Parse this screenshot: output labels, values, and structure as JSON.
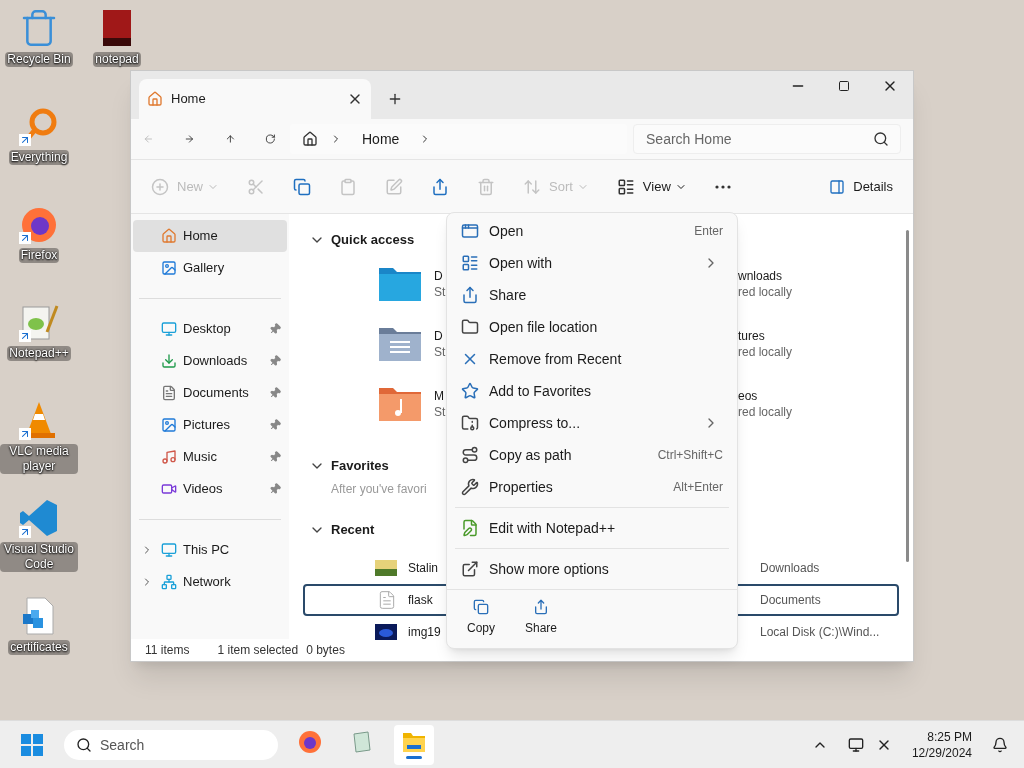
{
  "desktop_icons": [
    {
      "label": "Recycle Bin",
      "kind": "recycle",
      "shortcut": false
    },
    {
      "label": "Everything",
      "kind": "everything",
      "shortcut": true
    },
    {
      "label": "Firefox",
      "kind": "firefox",
      "shortcut": true
    },
    {
      "label": "Notepad++",
      "kind": "notepadpp",
      "shortcut": true
    },
    {
      "label": "VLC media player",
      "kind": "vlc",
      "shortcut": true
    },
    {
      "label": "Visual Studio Code",
      "kind": "vscode",
      "shortcut": true
    },
    {
      "label": "certificates",
      "kind": "certs",
      "shortcut": false
    }
  ],
  "desktop_icons_column_2": [
    {
      "label": "notepad",
      "kind": "book",
      "shortcut": false
    }
  ],
  "window": {
    "tabs": [
      {
        "label": "Home",
        "selected": true
      }
    ],
    "address": {
      "breadcrumb": [
        "Home"
      ],
      "search_placeholder": "Search Home"
    },
    "commands": [
      {
        "kind": "new",
        "label": "New",
        "disabled": true
      },
      {
        "kind": "cut",
        "disabled": true
      },
      {
        "kind": "copy",
        "disabled": false
      },
      {
        "kind": "paste",
        "disabled": true
      },
      {
        "kind": "rename",
        "disabled": true
      },
      {
        "kind": "share",
        "disabled": false
      },
      {
        "kind": "delete",
        "disabled": true
      },
      {
        "kind": "sort",
        "label": "Sort",
        "disabled": true
      },
      {
        "kind": "view",
        "label": "View",
        "disabled": false
      },
      {
        "kind": "more",
        "disabled": false
      }
    ],
    "details_button": "Details",
    "sidebar": {
      "top": [
        {
          "label": "Home",
          "kind": "home",
          "selected": true
        },
        {
          "label": "Gallery",
          "kind": "gallery",
          "selected": false
        }
      ],
      "pinned": [
        {
          "label": "Desktop",
          "kind": "desktop",
          "selected": false,
          "pinned": true
        },
        {
          "label": "Downloads",
          "kind": "downloads",
          "selected": false,
          "pinned": true
        },
        {
          "label": "Documents",
          "kind": "documents",
          "selected": false,
          "pinned": true
        },
        {
          "label": "Pictures",
          "kind": "pictures",
          "selected": false,
          "pinned": true
        },
        {
          "label": "Music",
          "kind": "music",
          "selected": false,
          "pinned": true
        },
        {
          "label": "Videos",
          "kind": "videos",
          "selected": false,
          "pinned": true
        }
      ],
      "locations": [
        {
          "label": "This PC",
          "kind": "pc",
          "selected": false,
          "expanded": false
        },
        {
          "label": "Network",
          "kind": "network",
          "selected": false,
          "expanded": false
        }
      ]
    },
    "quick_access": {
      "title": "Quick access",
      "expanded": true,
      "items": [
        {
          "kind": "desktop",
          "name": "D",
          "status": "St"
        },
        {
          "kind": "documents",
          "name": "D",
          "status": "St"
        },
        {
          "kind": "music",
          "name": "M",
          "status": "St"
        }
      ],
      "items_right": [
        {
          "name": "wnloads",
          "status": "red locally"
        },
        {
          "name": "tures",
          "status": "red locally"
        },
        {
          "name": "eos",
          "status": "red locally"
        }
      ]
    },
    "favorites": {
      "title": "Favorites",
      "expanded": true,
      "hint": "After you've favori"
    },
    "recent": {
      "title": "Recent",
      "expanded": true,
      "rows": [
        {
          "kind": "image",
          "name": "Stalin",
          "location": "Downloads",
          "selected": false
        },
        {
          "kind": "text",
          "name": "flask",
          "location": "Documents",
          "selected": true
        },
        {
          "kind": "dark",
          "name": "img19",
          "location": "Local Disk (C:)\\Wind...",
          "selected": false
        }
      ]
    },
    "status_bar": {
      "count": "11 items",
      "selection": "1 item selected",
      "size": "0 bytes"
    }
  },
  "context_menu": {
    "items": [
      {
        "kind": "open",
        "label": "Open",
        "shortcut": "Enter",
        "submenu": false,
        "divider_above": false
      },
      {
        "kind": "openwith",
        "label": "Open with",
        "submenu": true,
        "divider_above": false
      },
      {
        "kind": "share",
        "label": "Share",
        "submenu": false,
        "divider_above": false
      },
      {
        "kind": "location",
        "label": "Open file location",
        "submenu": false,
        "divider_above": false
      },
      {
        "kind": "remove",
        "label": "Remove from Recent",
        "submenu": false,
        "divider_above": false
      },
      {
        "kind": "favorite",
        "label": "Add to Favorites",
        "submenu": false,
        "divider_above": false
      },
      {
        "kind": "compress",
        "label": "Compress to...",
        "submenu": true,
        "divider_above": false
      },
      {
        "kind": "copypath",
        "label": "Copy as path",
        "shortcut": "Ctrl+Shift+C",
        "submenu": false,
        "divider_above": false
      },
      {
        "kind": "properties",
        "label": "Properties",
        "shortcut": "Alt+Enter",
        "submenu": false,
        "divider_above": false
      },
      {
        "kind": "edit",
        "label": "Edit with Notepad++",
        "submenu": false,
        "divider_above": true
      },
      {
        "kind": "more",
        "label": "Show more options",
        "submenu": false,
        "divider_above": true
      }
    ],
    "actions": [
      {
        "kind": "copy",
        "label": "Copy"
      },
      {
        "kind": "share",
        "label": "Share"
      }
    ]
  },
  "taskbar": {
    "search_placeholder": "Search",
    "apps": [
      {
        "kind": "firefox",
        "active": false
      },
      {
        "kind": "notepadpp",
        "active": false
      },
      {
        "kind": "explorer",
        "active": true
      }
    ],
    "time": "8:25 PM",
    "date": "12/29/2024"
  }
}
